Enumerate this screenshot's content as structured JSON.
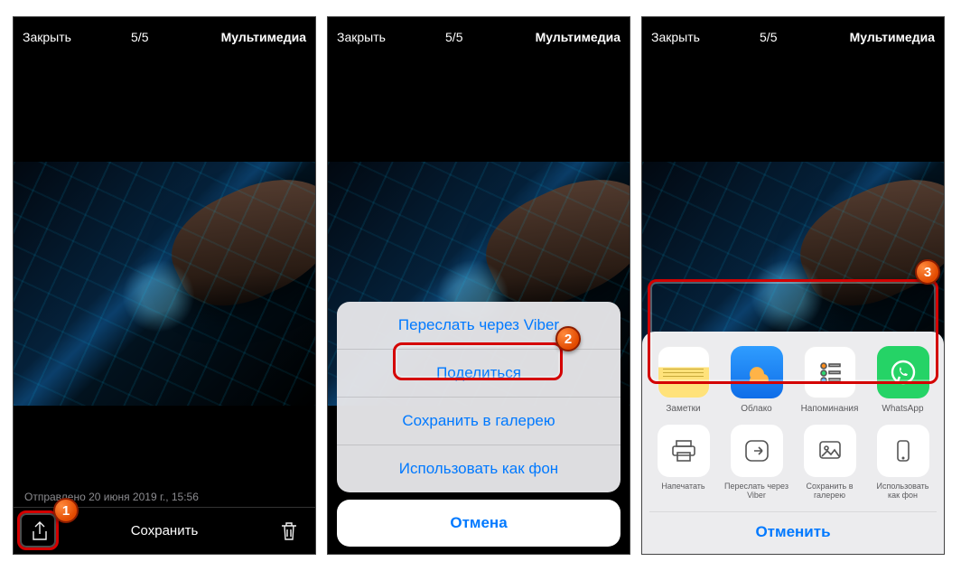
{
  "top": {
    "close": "Закрыть",
    "count": "5/5",
    "mult": "Мультимедиа"
  },
  "s1": {
    "timestamp": "Отправлено 20 июня 2019 г., 15:56",
    "saveLabel": "Сохранить"
  },
  "s2": {
    "items": [
      "Переслать через Viber",
      "Поделиться",
      "Сохранить в галерею",
      "Использовать как фон"
    ],
    "cancel": "Отмена"
  },
  "s3": {
    "apps": [
      {
        "name": "Заметки"
      },
      {
        "name": "Облако"
      },
      {
        "name": "Напоминания"
      },
      {
        "name": "WhatsApp"
      }
    ],
    "actions": [
      {
        "name": "Напечатать"
      },
      {
        "name": "Переслать через Viber"
      },
      {
        "name": "Сохранить в галерею"
      },
      {
        "name": "Использовать как фон"
      }
    ],
    "cancel": "Отменить"
  },
  "badges": {
    "b1": "1",
    "b2": "2",
    "b3": "3"
  }
}
